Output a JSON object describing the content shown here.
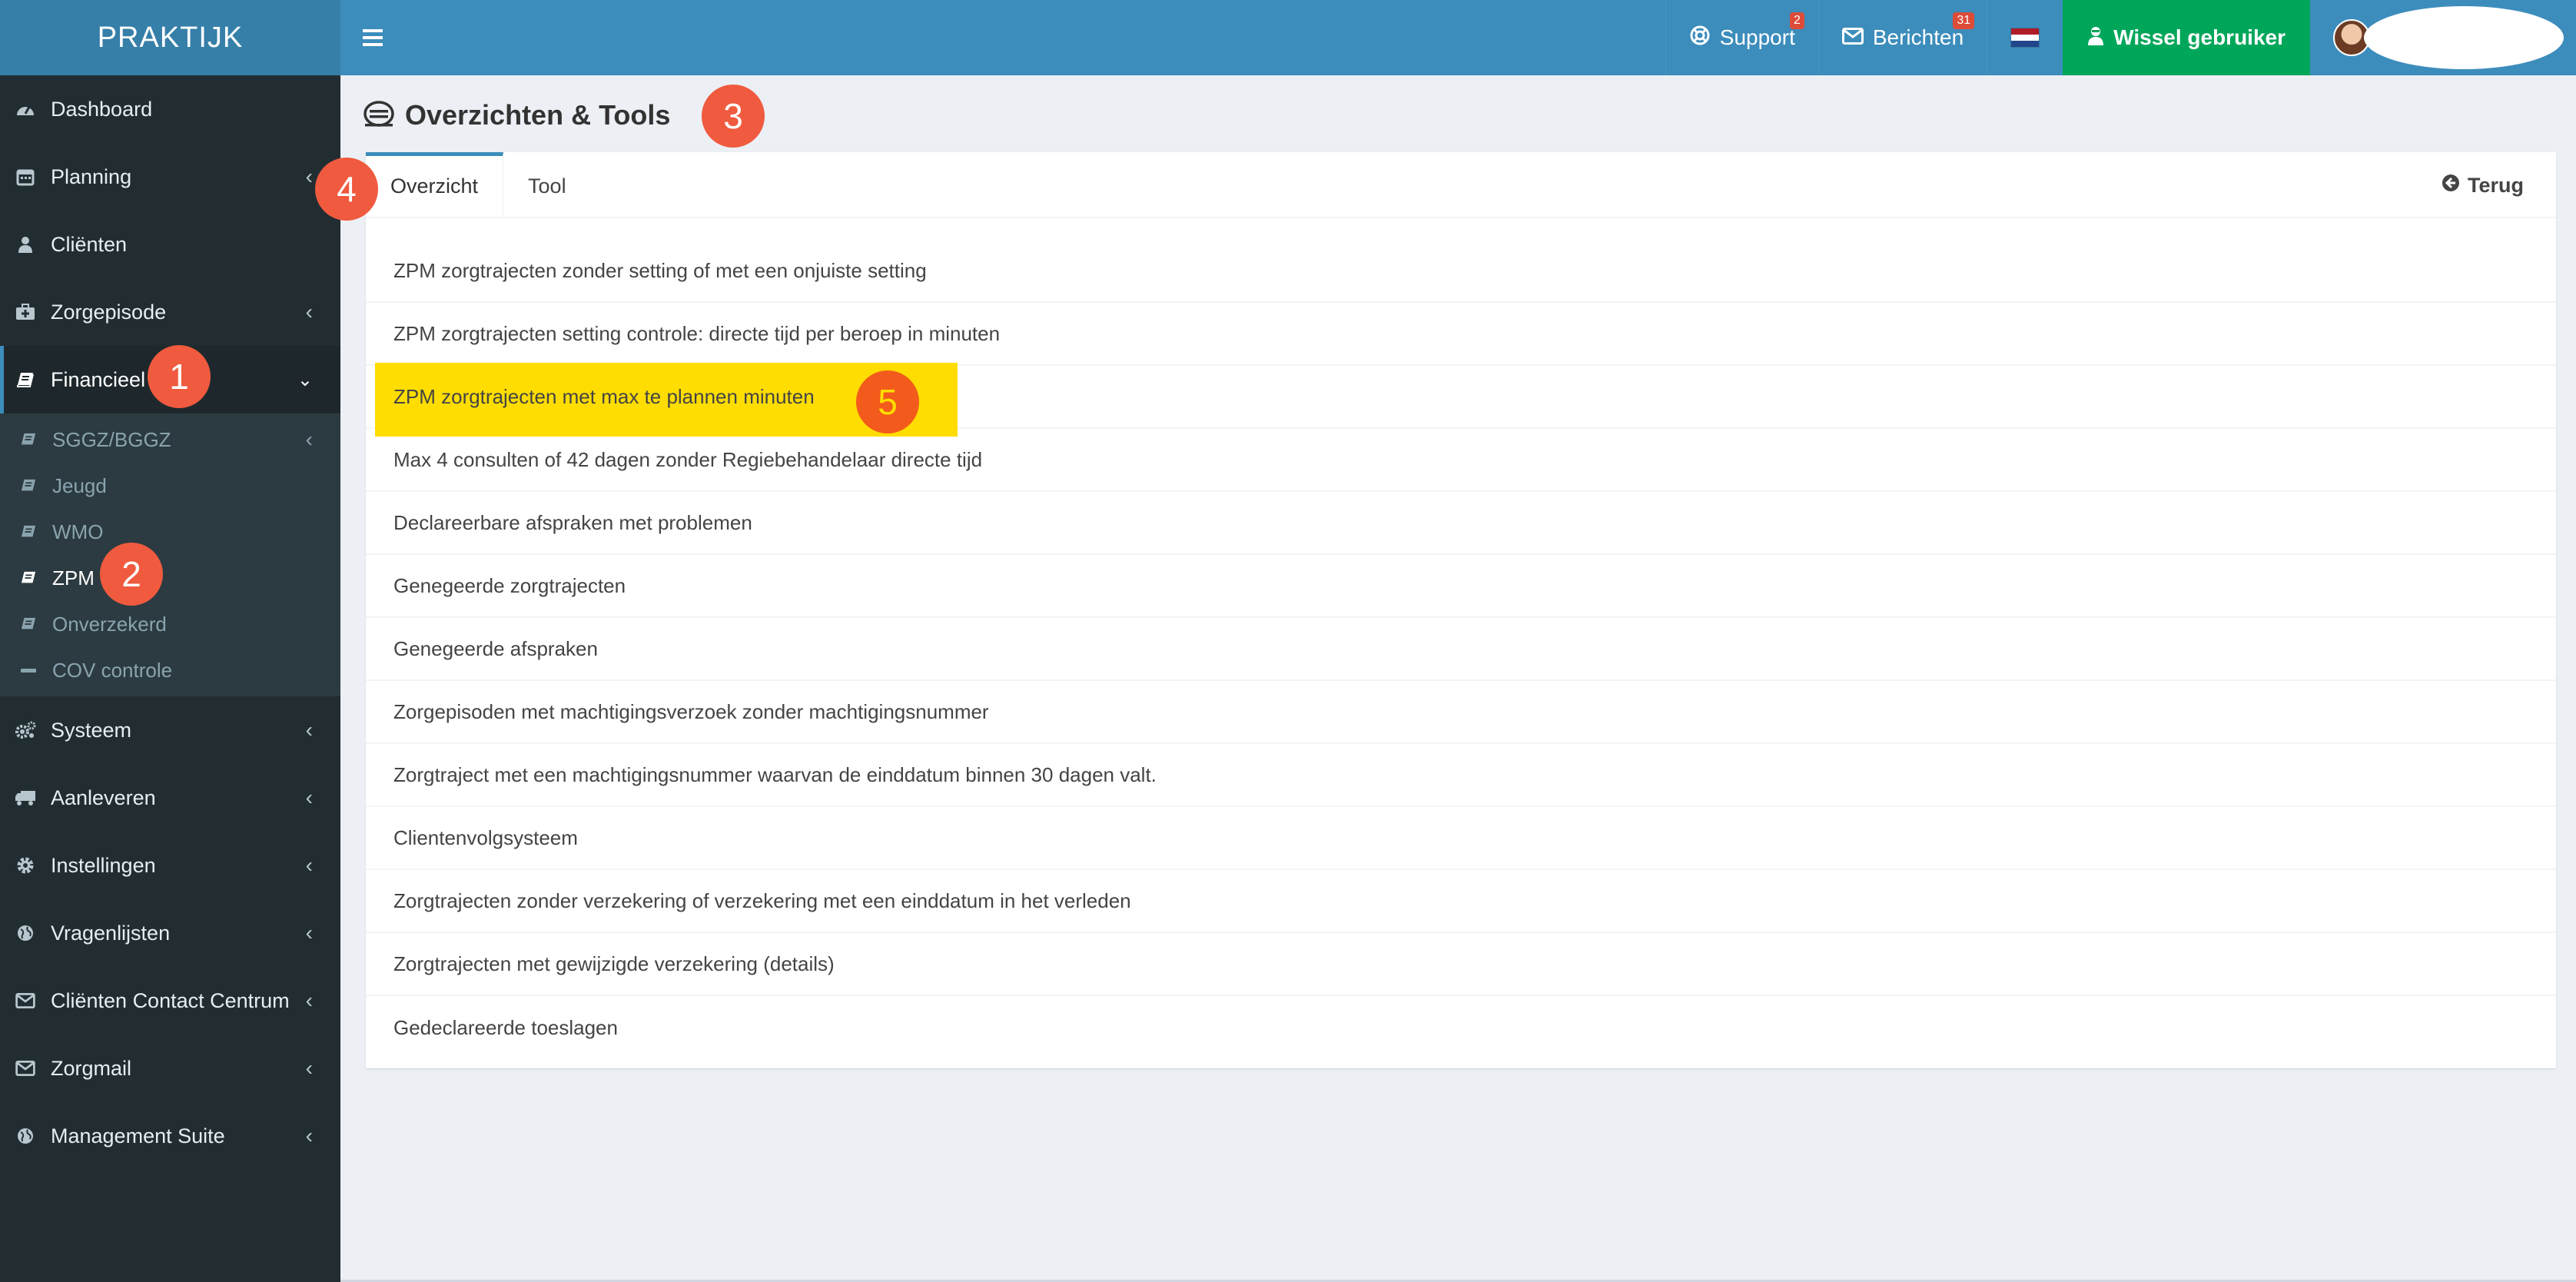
{
  "header": {
    "brand": "PRAKTIJK",
    "support_label": "Support",
    "support_badge": "2",
    "messages_label": "Berichten",
    "messages_badge": "31",
    "switch_user_label": "Wissel gebruiker"
  },
  "sidebar": {
    "items": [
      {
        "label": "Dashboard"
      },
      {
        "label": "Planning"
      },
      {
        "label": "Cliënten"
      },
      {
        "label": "Zorgepisode"
      },
      {
        "label": "Financieel"
      }
    ],
    "financieel_sub": [
      {
        "label": "SGGZ/BGGZ"
      },
      {
        "label": "Jeugd"
      },
      {
        "label": "WMO"
      },
      {
        "label": "ZPM"
      },
      {
        "label": "Onverzekerd"
      },
      {
        "label": "COV controle"
      }
    ],
    "items_after": [
      {
        "label": "Systeem"
      },
      {
        "label": "Aanleveren"
      },
      {
        "label": "Instellingen"
      },
      {
        "label": "Vragenlijsten"
      },
      {
        "label": "Cliënten Contact Centrum"
      },
      {
        "label": "Zorgmail"
      },
      {
        "label": "Management Suite"
      }
    ]
  },
  "main": {
    "title": "Overzichten & Tools",
    "tabs": [
      {
        "label": "Overzicht"
      },
      {
        "label": "Tool"
      }
    ],
    "back_label": "Terug",
    "rows": [
      "ZPM zorgtrajecten zonder setting of met een onjuiste setting",
      "ZPM zorgtrajecten setting controle: directe tijd per beroep in minuten",
      "ZPM zorgtrajecten met max te plannen minuten",
      "Max 4 consulten of 42 dagen zonder Regiebehandelaar directe tijd",
      "Declareerbare afspraken met problemen",
      "Genegeerde zorgtrajecten",
      "Genegeerde afspraken",
      "Zorgepisoden met machtigingsverzoek zonder machtigingsnummer",
      "Zorgtraject met een machtigingsnummer waarvan de einddatum binnen 30 dagen valt.",
      "Clientenvolgsysteem",
      "Zorgtrajecten zonder verzekering of verzekering met een einddatum in het verleden",
      "Zorgtrajecten met gewijzigde verzekering (details)",
      "Gedeclareerde toeslagen"
    ]
  },
  "annotations": {
    "m1": "1",
    "m2": "2",
    "m3": "3",
    "m4": "4",
    "m5": "5"
  },
  "colors": {
    "brand_dark": "#367fa9",
    "topbar": "#3c8dbc",
    "sidebar": "#222d32",
    "success": "#00a65a",
    "highlight": "#ffdd00",
    "marker": "#f05a3e"
  },
  "icons": [
    "menu-icon",
    "lifebuoy-icon",
    "envelope-icon",
    "nl-flag-icon",
    "user-secret-icon",
    "dashboard-icon",
    "calendar-icon",
    "user-icon",
    "medkit-icon",
    "book-icon",
    "minus-icon",
    "cogs-icon",
    "truck-icon",
    "gear-icon",
    "globe-icon",
    "chevron-left-icon",
    "chevron-down-icon",
    "circle-arrow-left-icon",
    "hdd-icon"
  ]
}
